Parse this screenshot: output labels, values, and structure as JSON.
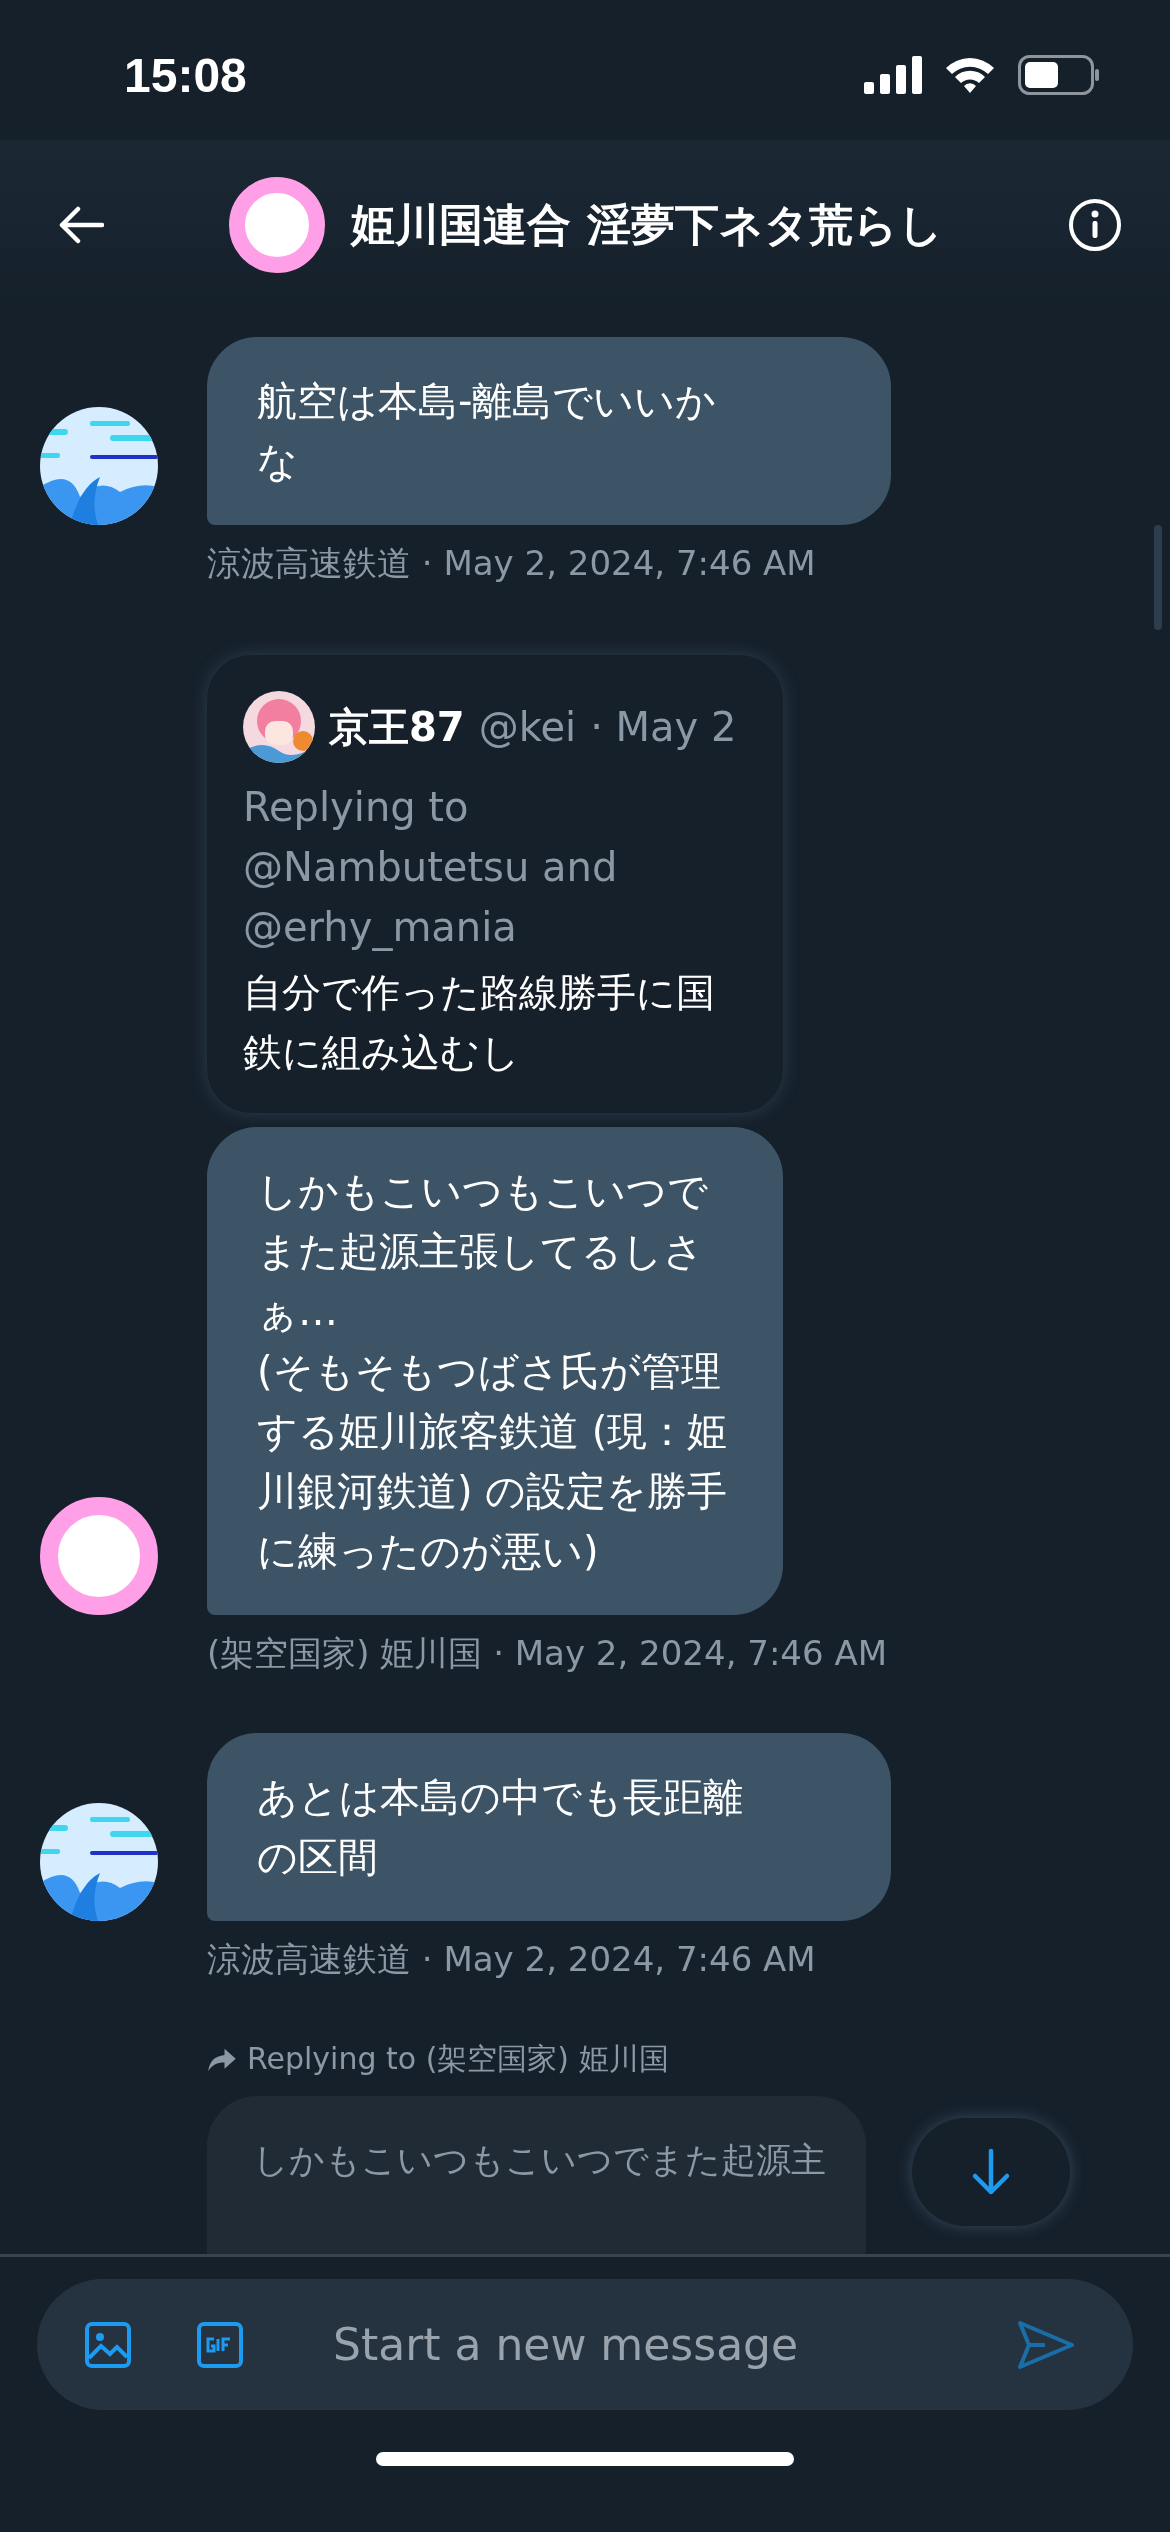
{
  "status_bar": {
    "time": "15:08"
  },
  "header": {
    "title": "姫川国連合 淫夢下ネタ荒らし"
  },
  "messages": [
    {
      "kind": "text",
      "avatar": {
        "kind": "wave"
      },
      "text": "航空は本島-離島でいいかな",
      "meta": "涼波高速鉄道 · May 2, 2024, 7:46 AM"
    },
    {
      "kind": "quote",
      "avatar": {
        "kind": "ring"
      },
      "quote": {
        "name": "京王87",
        "handle": "@kei",
        "date": "· May 2",
        "replying": "Replying to @Nambutetsu and @erhy_mania",
        "text": "自分で作った路線勝手に国鉄に組み込むし"
      },
      "text": "しかもこいつもこいつでまた起源主張してるしさぁ…\n(そもそもつばさ氏が管理する姫川旅客鉄道 (現：姫川銀河鉄道) の設定を勝手に練ったのが悪い)",
      "meta": "(架空国家) 姫川国 · May 2, 2024, 7:46 AM"
    },
    {
      "kind": "text",
      "avatar": {
        "kind": "wave"
      },
      "text": "あとは本島の中でも長距離の区間",
      "meta": "涼波高速鉄道 · May 2, 2024, 7:46 AM"
    },
    {
      "kind": "reply",
      "reply_to": "Replying to (架空国家) 姫川国",
      "text": "しかもこいつもこいつでまた起源主"
    }
  ],
  "composer": {
    "placeholder": "Start a new message"
  }
}
